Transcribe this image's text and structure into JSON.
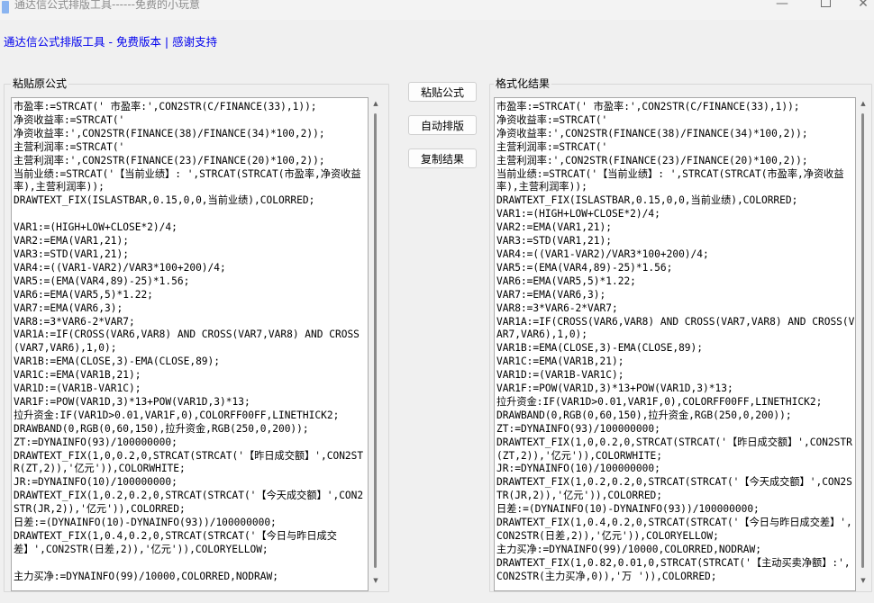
{
  "window": {
    "title": "通达信公式排版工具------免费的小玩意",
    "min_glyph": "—",
    "close_glyph": "✕"
  },
  "header": {
    "link_text": "通达信公式排版工具 - 免费版本 | 感谢支持"
  },
  "left_panel": {
    "label": "粘贴原公式",
    "content": "市盈率:=STRCAT(' 市盈率:',CON2STR(C/FINANCE(33),1));\n净资收益率:=STRCAT('\n净资收益率:',CON2STR(FINANCE(38)/FINANCE(34)*100,2));\n主营利润率:=STRCAT('\n主营利润率:',CON2STR(FINANCE(23)/FINANCE(20)*100,2));\n当前业绩:=STRCAT('【当前业绩】: ',STRCAT(STRCAT(市盈率,净资收益率),主营利润率));\nDRAWTEXT_FIX(ISLASTBAR,0.15,0,0,当前业绩),COLORRED;\n\nVAR1:=(HIGH+LOW+CLOSE*2)/4;\nVAR2:=EMA(VAR1,21);\nVAR3:=STD(VAR1,21);\nVAR4:=((VAR1-VAR2)/VAR3*100+200)/4;\nVAR5:=(EMA(VAR4,89)-25)*1.56;\nVAR6:=EMA(VAR5,5)*1.22;\nVAR7:=EMA(VAR6,3);\nVAR8:=3*VAR6-2*VAR7;\nVAR1A:=IF(CROSS(VAR6,VAR8) AND CROSS(VAR7,VAR8) AND CROSS(VAR7,VAR6),1,0);\nVAR1B:=EMA(CLOSE,3)-EMA(CLOSE,89);\nVAR1C:=EMA(VAR1B,21);\nVAR1D:=(VAR1B-VAR1C);\nVAR1F:=POW(VAR1D,3)*13+POW(VAR1D,3)*13;\n拉升资金:IF(VAR1D>0.01,VAR1F,0),COLORFF00FF,LINETHICK2;\nDRAWBAND(0,RGB(0,60,150),拉升资金,RGB(250,0,200));\nZT:=DYNAINFO(93)/100000000;\nDRAWTEXT_FIX(1,0,0.2,0,STRCAT(STRCAT('【昨日成交额】',CON2STR(ZT,2)),'亿元')),COLORWHITE;\nJR:=DYNAINFO(10)/100000000;\nDRAWTEXT_FIX(1,0.2,0.2,0,STRCAT(STRCAT('【今天成交额】',CON2STR(JR,2)),'亿元')),COLORRED;\n日差:=(DYNAINFO(10)-DYNAINFO(93))/100000000;\nDRAWTEXT_FIX(1,0.4,0.2,0,STRCAT(STRCAT('【今日与昨日成交差】',CON2STR(日差,2)),'亿元')),COLORYELLOW;\n\n主力买净:=DYNAINFO(99)/10000,COLORRED,NODRAW;"
  },
  "right_panel": {
    "label": "格式化结果",
    "content": "市盈率:=STRCAT(' 市盈率:',CON2STR(C/FINANCE(33),1));\n净资收益率:=STRCAT('\n净资收益率:',CON2STR(FINANCE(38)/FINANCE(34)*100,2));\n主营利润率:=STRCAT('\n主营利润率:',CON2STR(FINANCE(23)/FINANCE(20)*100,2));\n当前业绩:=STRCAT('【当前业绩】: ',STRCAT(STRCAT(市盈率,净资收益率),主营利润率));\nDRAWTEXT_FIX(ISLASTBAR,0.15,0,0,当前业绩),COLORRED;\nVAR1:=(HIGH+LOW+CLOSE*2)/4;\nVAR2:=EMA(VAR1,21);\nVAR3:=STD(VAR1,21);\nVAR4:=((VAR1-VAR2)/VAR3*100+200)/4;\nVAR5:=(EMA(VAR4,89)-25)*1.56;\nVAR6:=EMA(VAR5,5)*1.22;\nVAR7:=EMA(VAR6,3);\nVAR8:=3*VAR6-2*VAR7;\nVAR1A:=IF(CROSS(VAR6,VAR8) AND CROSS(VAR7,VAR8) AND CROSS(VAR7,VAR6),1,0);\nVAR1B:=EMA(CLOSE,3)-EMA(CLOSE,89);\nVAR1C:=EMA(VAR1B,21);\nVAR1D:=(VAR1B-VAR1C);\nVAR1F:=POW(VAR1D,3)*13+POW(VAR1D,3)*13;\n拉升资金:IF(VAR1D>0.01,VAR1F,0),COLORFF00FF,LINETHICK2;\nDRAWBAND(0,RGB(0,60,150),拉升资金,RGB(250,0,200));\nZT:=DYNAINFO(93)/100000000;\nDRAWTEXT_FIX(1,0,0.2,0,STRCAT(STRCAT('【昨日成交额】',CON2STR(ZT,2)),'亿元')),COLORWHITE;\nJR:=DYNAINFO(10)/100000000;\nDRAWTEXT_FIX(1,0.2,0.2,0,STRCAT(STRCAT('【今天成交额】',CON2STR(JR,2)),'亿元')),COLORRED;\n日差:=(DYNAINFO(10)-DYNAINFO(93))/100000000;\nDRAWTEXT_FIX(1,0.4,0.2,0,STRCAT(STRCAT('【今日与昨日成交差】',CON2STR(日差,2)),'亿元')),COLORYELLOW;\n主力买净:=DYNAINFO(99)/10000,COLORRED,NODRAW;\nDRAWTEXT_FIX(1,0.82,0.01,0,STRCAT(STRCAT('【主动买卖净额】:',CON2STR(主力买净,0)),'万 ')),COLORRED;"
  },
  "buttons": {
    "paste": "粘贴公式",
    "format": "自动排版",
    "copy": "复制结果"
  }
}
